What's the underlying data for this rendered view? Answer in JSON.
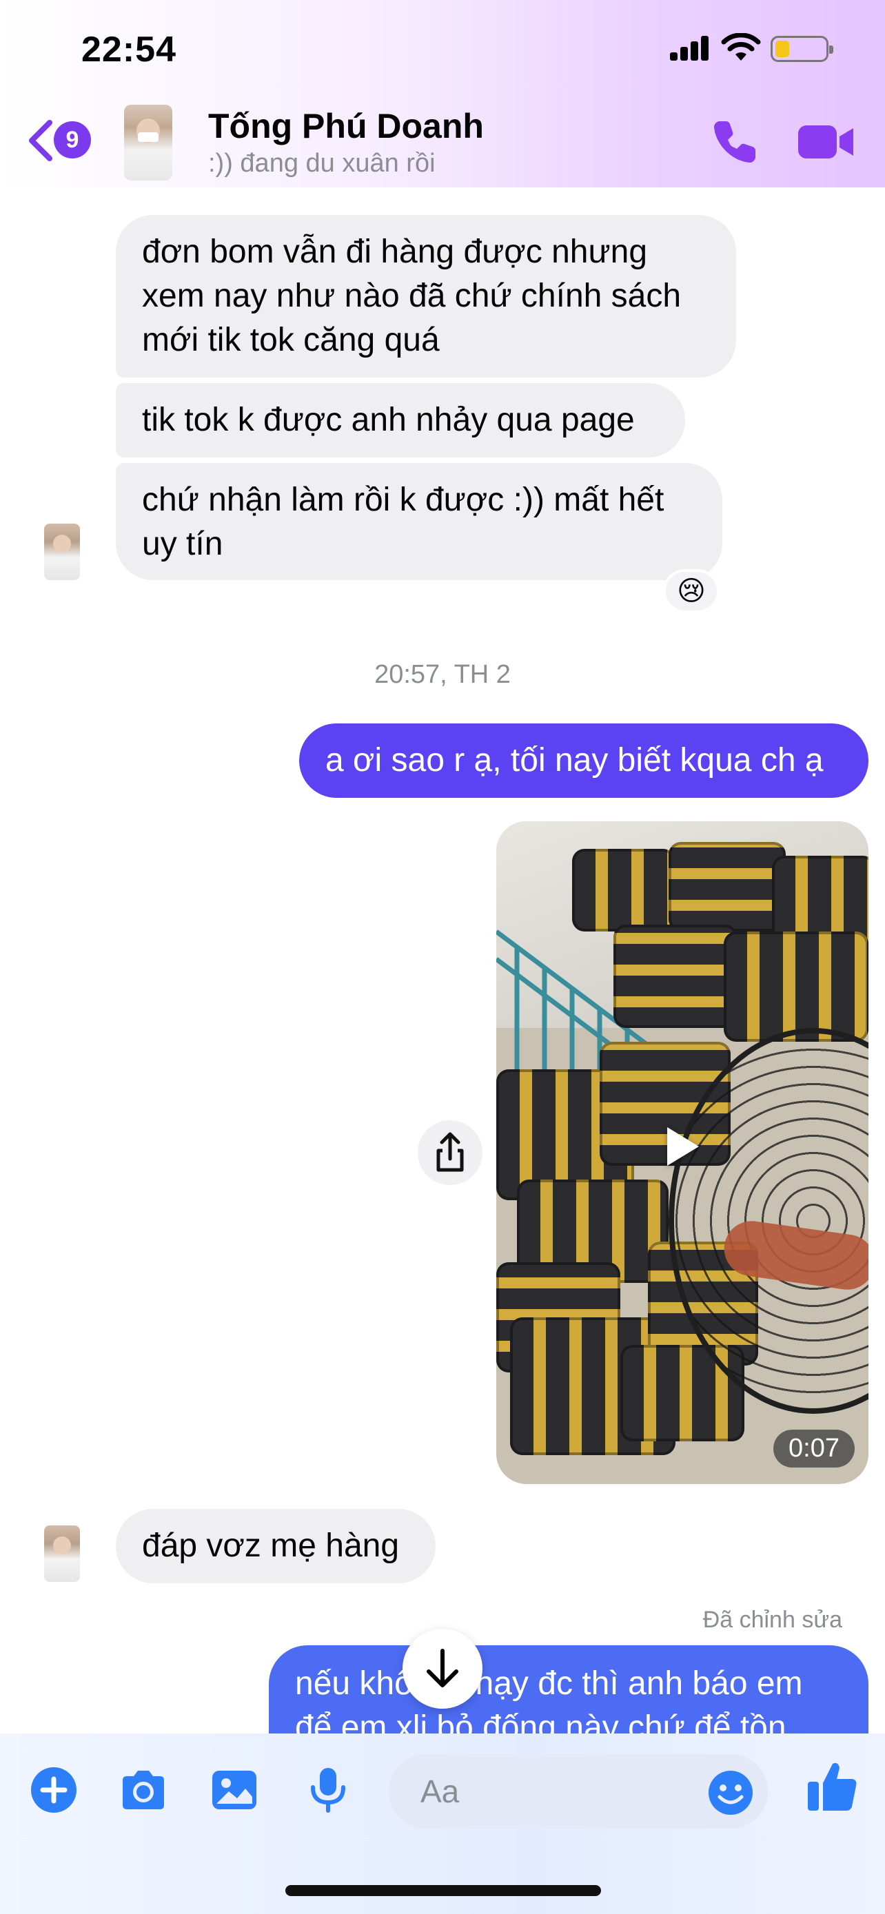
{
  "status_bar": {
    "time": "22:54"
  },
  "header": {
    "back_badge": "9",
    "contact_name": "Tống Phú Doanh",
    "contact_status": ":)) đang du xuân rồi"
  },
  "messages": {
    "in_1": [
      "đơn bom vẫn đi hàng được nhưng",
      "xem nay như nào đã chứ chính sách",
      "mới tik tok căng quá"
    ],
    "in_2": "tik tok k được anh nhảy qua page",
    "in_3": [
      "chứ nhận làm rồi k được :)) mất hết",
      "uy tín"
    ],
    "reaction": "😢",
    "timestamp": "20:57, TH 2",
    "out_1": "a ơi sao r ạ, tối nay biết kqua ch ạ",
    "video_duration": "0:07",
    "in_4": "đáp vơz mẹ hàng",
    "edited_label": "Đã chỉnh sửa",
    "out_2": [
      "nếu không chạy đc thì anh báo em",
      "để em xli bỏ đống này chứ để tồn"
    ]
  },
  "composer": {
    "placeholder": "Aa"
  },
  "colors": {
    "outgoing": "#5b42f3",
    "incoming": "#efeff1",
    "accent": "#7c3aed",
    "composer_icons": "#2d7ff9"
  },
  "icons": [
    "back-chevron-icon",
    "phone-icon",
    "video-camera-icon",
    "share-icon",
    "play-icon",
    "arrow-down-icon",
    "plus-icon",
    "camera-icon",
    "image-icon",
    "microphone-icon",
    "smiley-icon",
    "thumbs-up-icon"
  ]
}
